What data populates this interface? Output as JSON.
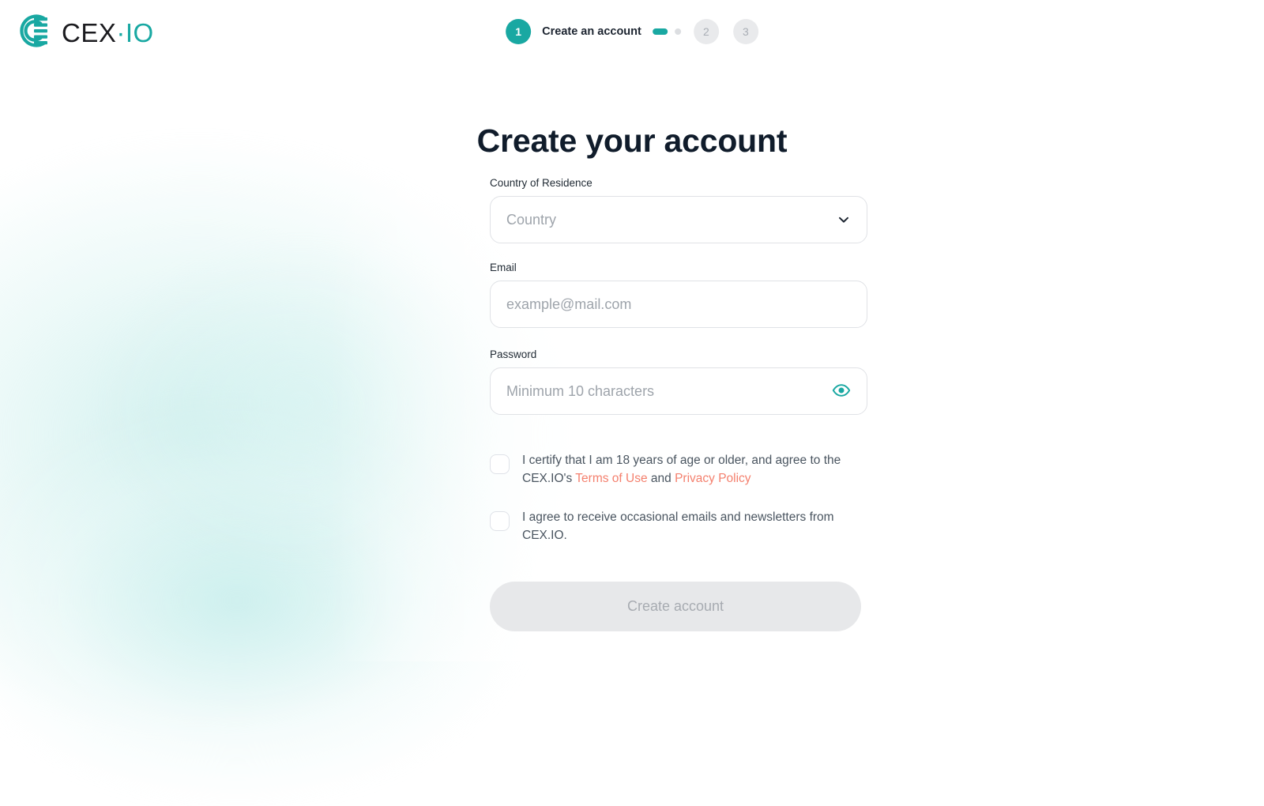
{
  "brand": {
    "logo_icon": "cex-logo-mark",
    "wordmark_cex": "CEX",
    "wordmark_separator": "·",
    "wordmark_io": "IO",
    "accent_color": "#19a8a2",
    "link_color": "#f4806e"
  },
  "stepper": {
    "steps": [
      {
        "number": "1",
        "label": "Create an account",
        "state": "active"
      },
      {
        "number": "2",
        "label": "",
        "state": "inactive"
      },
      {
        "number": "3",
        "label": "",
        "state": "inactive"
      }
    ],
    "connector": {
      "pill_color": "#19a8a2",
      "dot_color": "#dcdee1"
    }
  },
  "main": {
    "title": "Create your account",
    "fields": {
      "country": {
        "label": "Country of Residence",
        "placeholder": "Country",
        "value": "",
        "icon": "chevron-down-icon"
      },
      "email": {
        "label": "Email",
        "placeholder": "example@mail.com",
        "value": ""
      },
      "password": {
        "label": "Password",
        "placeholder": "Minimum 10 characters",
        "value": "",
        "icon": "eye-icon"
      }
    },
    "consents": [
      {
        "checked": false,
        "text_before": "I certify that I am 18 years of age or older, and agree to the CEX.IO's ",
        "link_1": "Terms of Use",
        "text_between": " and ",
        "link_2": "Privacy Policy",
        "text_after": ""
      },
      {
        "checked": false,
        "text_before": "I agree to receive occasional emails and newsletters from CEX.IO.",
        "link_1": "",
        "text_between": "",
        "link_2": "",
        "text_after": ""
      }
    ],
    "submit_label": "Create account",
    "submit_enabled": false
  }
}
